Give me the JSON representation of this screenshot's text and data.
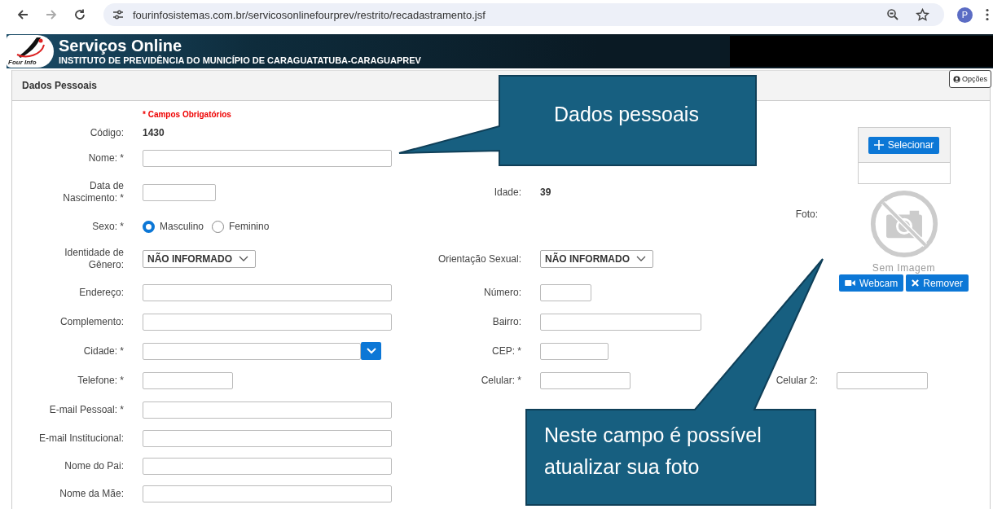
{
  "browser": {
    "url": "fourinfosistemas.com.br/servicosonlinefourprev/restrito/recadastramento.jsf",
    "avatar": "P"
  },
  "header": {
    "logo_text": "Four Info",
    "title": "Serviços Online",
    "subtitle": "INSTITUTO DE PREVIDÊNCIA DO MUNICÍPIO DE CARAGUATATUBA-CARAGUAPREV"
  },
  "panel": {
    "title": "Dados Pessoais",
    "options_button": "Opções"
  },
  "form": {
    "required_note": "* Campos Obrigatórios",
    "rows": [
      {
        "left": {
          "label": "Código:",
          "kind": "text",
          "value": "1430"
        }
      },
      {
        "left": {
          "label": "Nome: *",
          "kind": "input"
        }
      },
      {
        "left": {
          "label": "Data de\nNascimento: *",
          "kind": "input"
        },
        "middle": {
          "label": "Idade:",
          "kind": "text",
          "value": "39"
        }
      },
      {
        "left": {
          "label": "Sexo: *",
          "kind": "radio",
          "options": [
            {
              "label": "Masculino",
              "selected": true
            },
            {
              "label": "Feminino",
              "selected": false
            }
          ]
        }
      },
      {
        "left": {
          "label": "Identidade de\nGênero:",
          "kind": "select",
          "value": "NÃO INFORMADO"
        },
        "middle": {
          "label": "Orientação Sexual:",
          "kind": "select",
          "value": "NÃO INFORMADO"
        }
      },
      {
        "left": {
          "label": "Endereço:",
          "kind": "input"
        },
        "middle": {
          "label": "Número:",
          "kind": "input"
        }
      },
      {
        "left": {
          "label": "Complemento:",
          "kind": "input"
        },
        "middle": {
          "label": "Bairro:",
          "kind": "input"
        }
      },
      {
        "left": {
          "label": "Cidade: *",
          "kind": "combo"
        },
        "middle": {
          "label": "CEP: *",
          "kind": "input"
        }
      },
      {
        "left": {
          "label": "Telefone: *",
          "kind": "input"
        },
        "middle": {
          "label": "Celular: *",
          "kind": "input"
        },
        "right": {
          "label": "Celular 2:",
          "kind": "input"
        }
      },
      {
        "left": {
          "label": "E-mail Pessoal: *",
          "kind": "input"
        }
      },
      {
        "left": {
          "label": "E-mail Institucional:",
          "kind": "input"
        }
      },
      {
        "left": {
          "label": "Nome do Pai:",
          "kind": "input"
        }
      },
      {
        "left": {
          "label": "Nome da Mãe:",
          "kind": "input"
        }
      }
    ],
    "photo": {
      "label": "Foto:",
      "select_button": "Selecionar",
      "empty_text": "Sem Imagem",
      "buttons": [
        {
          "kind": "webcam",
          "label": "Webcam"
        },
        {
          "kind": "remove",
          "label": "Remover"
        }
      ]
    }
  },
  "callouts": [
    {
      "text": "Dados pessoais"
    },
    {
      "text": "Neste campo é possível atualizar sua foto"
    }
  ]
}
